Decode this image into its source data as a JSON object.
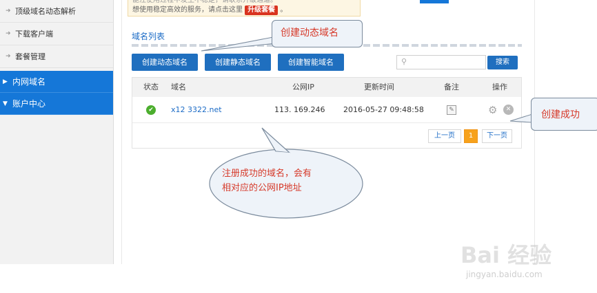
{
  "sidebar": {
    "sub_items": [
      {
        "label": "顶级域名动态解析"
      },
      {
        "label": "下载客户端"
      },
      {
        "label": "套餐管理"
      }
    ],
    "main_items": [
      {
        "label": "内网域名",
        "caret": "▶"
      },
      {
        "label": "账户中心",
        "caret": "▼"
      }
    ],
    "sub_bullet": "➜"
  },
  "notice": {
    "line1": "能注使用过程中发生不稳定，请联系升级通道。",
    "line2": "想使用稳定高效的服务，请点击这里",
    "upgrade_label": "升级套餐",
    "tail": "。"
  },
  "section": {
    "title": "域名列表"
  },
  "buttons": {
    "create_dynamic": "创建动态域名",
    "create_static": "创建静态域名",
    "create_smart": "创建智能域名",
    "search": "搜索"
  },
  "search": {
    "placeholder": "",
    "icon": "search-icon"
  },
  "table": {
    "headers": {
      "status": "状态",
      "domain": "域名",
      "ip": "公网IP",
      "updated": "更新时间",
      "note": "备注",
      "ops": "操作"
    },
    "rows": [
      {
        "status": "✔",
        "domain": "x12      3322.net",
        "ip": "113.      169.246",
        "updated": "2016-05-27 09:48:58"
      }
    ]
  },
  "pagination": {
    "prev": "上一页",
    "current": "1",
    "next": "下一页"
  },
  "callouts": {
    "create_dynamic": "创建动态域名",
    "success": "创建成功",
    "note_line1": "注册成功的域名，会有",
    "note_line2": "相对应的公网IP地址"
  },
  "watermark": {
    "logo": "Bai 经验",
    "url": "jingyan.baidu.com"
  },
  "colors": {
    "accent": "#1577d8",
    "button": "#1f6fbf",
    "success": "#4cae2e",
    "callout_text": "#d63a2a",
    "pager_active": "#f7a21c"
  }
}
